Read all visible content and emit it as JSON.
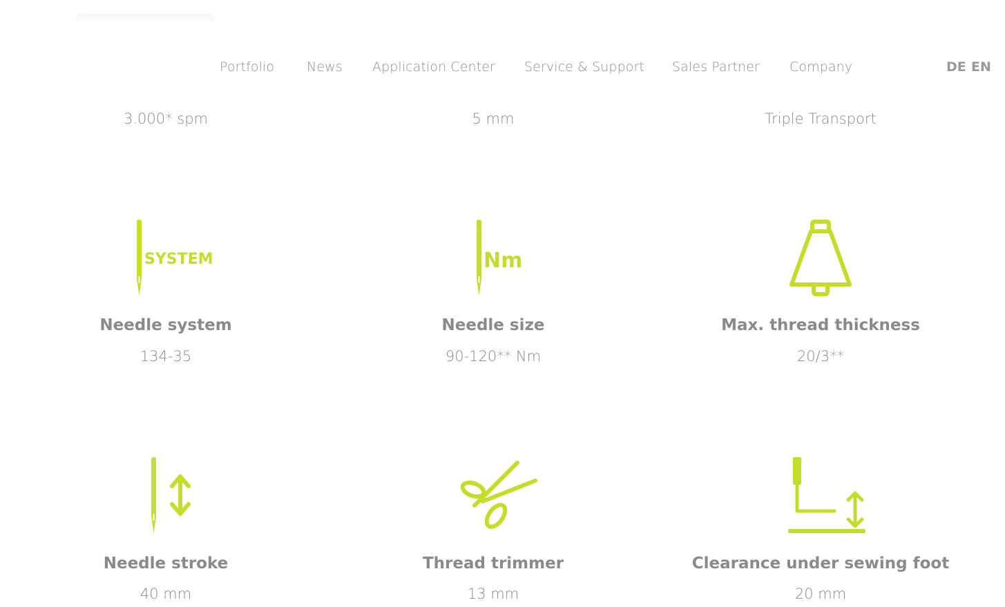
{
  "header": {
    "nav": [
      {
        "label": "Portfolio"
      },
      {
        "label": "News"
      },
      {
        "label": "Application Center"
      },
      {
        "label": "Service & Support"
      },
      {
        "label": "Sales Partner"
      },
      {
        "label": "Company"
      }
    ],
    "languages": {
      "de": "DE",
      "en": "EN"
    }
  },
  "top_values": [
    {
      "value": "3.000* spm"
    },
    {
      "value": "5 mm"
    },
    {
      "value": "Triple Transport"
    }
  ],
  "specs": [
    {
      "icon": "needle-system-icon",
      "icon_text": "SYSTEM",
      "label": "Needle system",
      "value": "134-35"
    },
    {
      "icon": "needle-size-icon",
      "icon_text": "Nm",
      "label": "Needle size",
      "value": "90-120** Nm"
    },
    {
      "icon": "thread-cone-icon",
      "label": "Max. thread thickness",
      "value": "20/3**"
    },
    {
      "icon": "needle-stroke-icon",
      "label": "Needle stroke",
      "value": "40 mm"
    },
    {
      "icon": "scissors-icon",
      "label": "Thread trimmer",
      "value": "13 mm"
    },
    {
      "icon": "foot-clearance-icon",
      "label": "Clearance under sewing foot",
      "value": "20 mm"
    }
  ],
  "colors": {
    "accent": "#c4dc2a",
    "text": "#8a8a8a"
  }
}
